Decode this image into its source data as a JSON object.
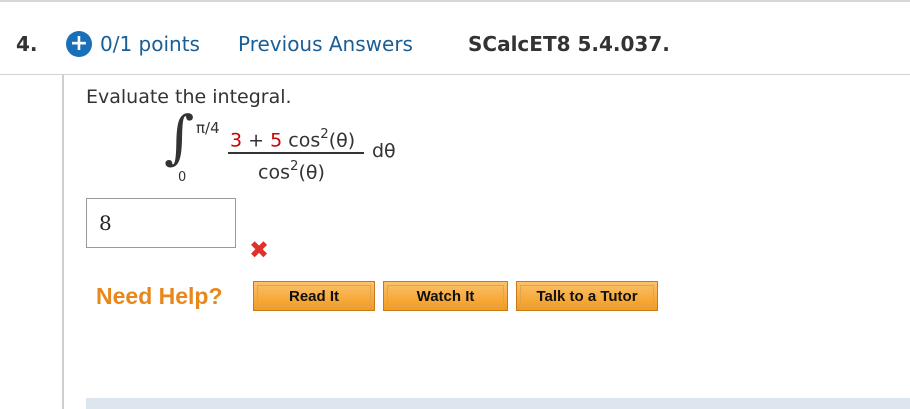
{
  "question": {
    "number": "4.",
    "points": "0/1 points",
    "previous_answers": "Previous Answers",
    "section_code": "SCalcET8 5.4.037."
  },
  "prompt": "Evaluate the integral.",
  "integral": {
    "upper_limit": "π/4",
    "lower_limit": "0",
    "numerator": {
      "coef1": "3",
      "plus": "+",
      "coef2": "5",
      "term": "cos",
      "exponent": "2",
      "arg": "(θ)"
    },
    "denominator": {
      "term": "cos",
      "exponent": "2",
      "arg": "(θ)"
    },
    "differential": "dθ"
  },
  "answer": {
    "value": "8",
    "status_icon": "wrong-x-icon",
    "status_color": "#e0302b"
  },
  "help": {
    "label": "Need Help?",
    "buttons": [
      "Read It",
      "Watch It",
      "Talk to a Tutor"
    ]
  },
  "colors": {
    "link": "#1a5e96",
    "accent_orange": "#e7871c",
    "plus_icon": "#1a6fb9",
    "highlight_red": "#cc0000"
  }
}
